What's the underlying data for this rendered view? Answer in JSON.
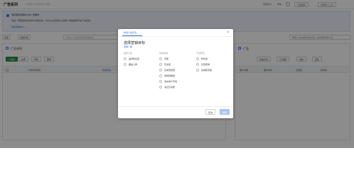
{
  "header": {
    "title": "广告系列",
    "subtitle": "一键创建广告系列和广告组",
    "links": [
      "营销秘书",
      "帮助"
    ],
    "buttons": [
      "全部编辑",
      "批量导入工具"
    ]
  },
  "notice": {
    "lines": [
      "现有诸多营销中心新广告要求",
      "系统一键帮助新建营销计划和投放，您可以在营销中心查看广告数据和修改广告设置。",
      "前往营销中心 >"
    ]
  },
  "filters": {
    "buttons": [
      "投放",
      "投放状态"
    ],
    "search_placeholder": "请输入广告系列名称或者搜索",
    "date_label": "时间：2020年09月12日 ~ 2020年09月17日"
  },
  "left_panel": {
    "title": "广告系列",
    "toolbar": [
      "+ 新建",
      "启用",
      "暂停",
      "删除"
    ],
    "columns": [
      "广告系列名称",
      "投放状态"
    ]
  },
  "right_panel": {
    "title": "广告",
    "toolbar": [
      "投放方式",
      "日·数据",
      "投放",
      "更多"
    ],
    "columns": [
      "展示次数",
      "展示成本",
      "点击量",
      "转化数"
    ]
  },
  "modal": {
    "tab": "新建广告系列",
    "heading": "选择营销目标",
    "link": "查看了解",
    "columns": [
      {
        "title": "品牌认知",
        "options": [
          "品牌知名度",
          "覆盖人群"
        ]
      },
      {
        "title": "意向拓展",
        "options": [
          "流量",
          "互动度",
          "应用安装量",
          "视频观看量",
          "潜在客户开发",
          "消息互动量"
        ]
      },
      {
        "title": "行动转化",
        "options": [
          "转化量",
          "目录促销",
          "店铺客流量"
        ]
      }
    ],
    "cancel": "取消",
    "confirm": "继续"
  },
  "colors": {
    "primary": "#2f6fd6",
    "success": "#2c8c4a",
    "overlay": "rgba(0,0,0,0.45)"
  }
}
